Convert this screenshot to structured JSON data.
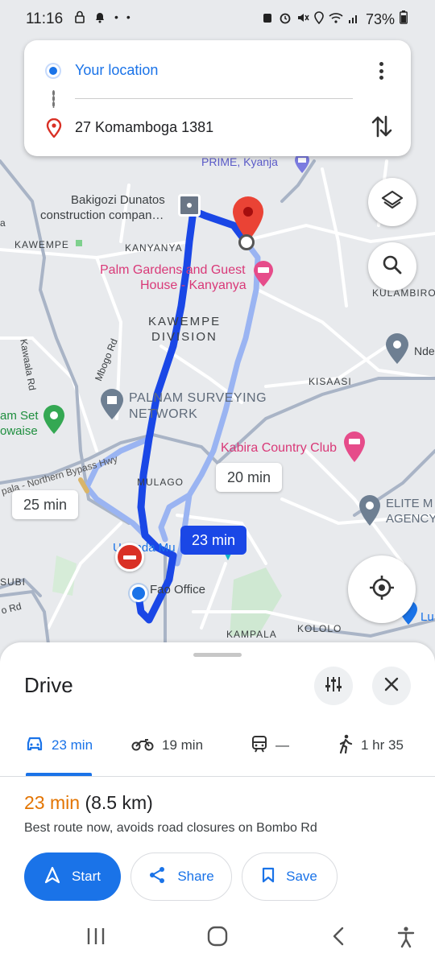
{
  "status_bar": {
    "time": "11:16",
    "battery_percent": "73%"
  },
  "directions": {
    "origin": "Your location",
    "destination": "27 Komamboga 1381"
  },
  "map": {
    "labels": {
      "prime": "PRIME, Kyanja",
      "bakigozi_line1": "Bakigozi Dunatos",
      "bakigozi_line2": "construction compan…",
      "kawempe": "KAWEMPE",
      "kanyanya": "KANYANYA",
      "palm_line1": "Palm Gardens and Guest",
      "palm_line2": "House - Kanyanya",
      "kulambiro": "KULAMBIRO",
      "kawempe_div_line1": "KAWEMPE",
      "kawempe_div_line2": "DIVISION",
      "kawaala_rd": "Kawaala Rd",
      "mbogo_rd": "Mbogo Rd",
      "nde": "Nde",
      "kisaasi": "KISAASI",
      "palnam_line1": "PALNAM SURVEYING",
      "palnam_line2": "NETWORK",
      "amset_line1": "am Set",
      "amset_line2": "owaise",
      "kabira": "Kabira Country Club",
      "northern_bypass": "pala - Northern Bypass Hwy",
      "mulago": "MULAGO",
      "elite_line1": "ELITE M",
      "elite_line2": "AGENCY",
      "uganda_mu": "Uganda Mu",
      "fao": "Fao Office",
      "subi": "SUBI",
      "o_rd": "o Rd",
      "kampala": "KAMPALA",
      "kololo": "KOLOLO",
      "lu": "Lu",
      "a": "a"
    },
    "route_times": {
      "selected": "23 min",
      "alt_a": "20 min",
      "alt_b": "25 min"
    }
  },
  "sheet": {
    "title": "Drive",
    "modes": [
      {
        "name": "car",
        "label": "23 min"
      },
      {
        "name": "motorcycle",
        "label": "19 min"
      },
      {
        "name": "transit",
        "label": "—"
      },
      {
        "name": "walk",
        "label": "1 hr 35"
      }
    ],
    "summary_duration": "23 min",
    "summary_distance": "(8.5 km)",
    "description": "Best route now, avoids road closures on Bombo Rd",
    "actions": {
      "start": "Start",
      "share": "Share",
      "save": "Save"
    }
  },
  "colors": {
    "accent": "#1a73e8",
    "route_selected": "#1a47e6",
    "route_alt": "#9ab4f2",
    "duration": "#e37400",
    "destination_pin": "#ea4335",
    "place_pink": "#d93978"
  }
}
